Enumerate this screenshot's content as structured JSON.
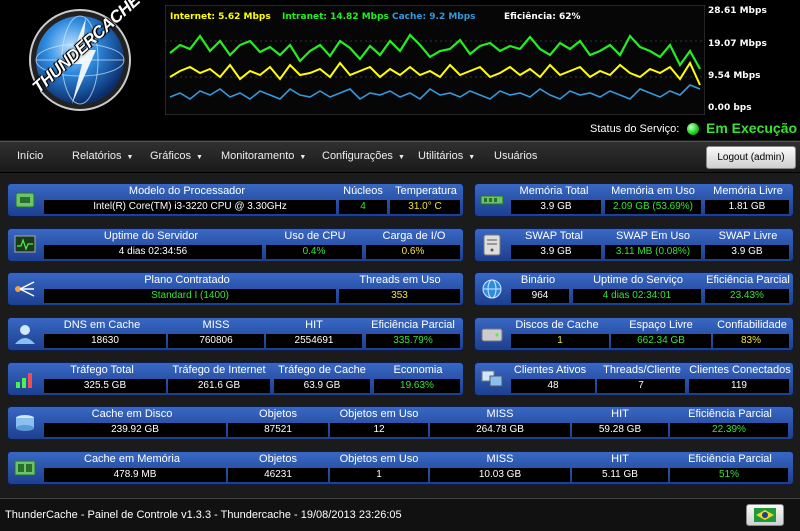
{
  "app": {
    "logo_text": "THUNDERCACHE",
    "legend": {
      "internet": "Internet: 5.62 Mbps",
      "intranet": "Intranet: 14.82 Mbps",
      "cache": "Cache: 9.2 Mbps",
      "eficiencia": "Eficiência: 62%"
    },
    "y_labels": [
      "28.61 Mbps",
      "19.07 Mbps",
      "9.54 Mbps",
      "0.00 bps"
    ],
    "status_label": "Status do Serviço:",
    "status_value": "Em Execução",
    "colors": {
      "internet": "#ffff00",
      "intranet": "#22ee22",
      "cache": "#3399dd",
      "eficiencia": "#ffffff",
      "value_green": "#37e237",
      "value_yellow": "#f2e23a"
    }
  },
  "nav": {
    "inicio": "Início",
    "relatorios": "Relatórios",
    "graficos": "Gráficos",
    "monitoramento": "Monitoramento",
    "configuracoes": "Configurações",
    "utilitarios": "Utilitários",
    "usuarios": "Usuários",
    "logout": "Logout (admin)"
  },
  "panels": {
    "cpu": {
      "icon": "chip-icon",
      "h": [
        "Modelo do Processador",
        "Núcleos",
        "Temperatura"
      ],
      "v": [
        "Intel(R) Core(TM) i3-3220 CPU @ 3.30GHz",
        "4",
        "31.0° C"
      ]
    },
    "mem": {
      "icon": "memory-icon",
      "h": [
        "Memória Total",
        "Memória em Uso",
        "Memória Livre"
      ],
      "v": [
        "3.9 GB",
        "2.09 GB (53.69%)",
        "1.81 GB"
      ]
    },
    "uptime": {
      "icon": "monitor-icon",
      "h": [
        "Uptime do Servidor",
        "Uso de CPU",
        "Carga de I/O"
      ],
      "v": [
        "4 dias 02:34:56",
        "0.4%",
        "0.6%"
      ]
    },
    "swap": {
      "icon": "server-icon",
      "h": [
        "SWAP Total",
        "SWAP Em Uso",
        "SWAP Livre"
      ],
      "v": [
        "3.9 GB",
        "3.11 MB (0.08%)",
        "3.9 GB"
      ]
    },
    "plano": {
      "icon": "network-icon",
      "h": [
        "Plano Contratado",
        "Threads em Uso"
      ],
      "v": [
        "Standard I (1400)",
        "353"
      ]
    },
    "binario": {
      "icon": "globe-icon",
      "h": [
        "Binário",
        "Uptime do Serviço",
        "Eficiência Parcial"
      ],
      "v": [
        "964",
        "4 dias 02:34:01",
        "23.43%"
      ]
    },
    "dns": {
      "icon": "user-icon",
      "h": [
        "DNS em Cache",
        "MISS",
        "HIT",
        "Eficiência Parcial"
      ],
      "v": [
        "18630",
        "760806",
        "2554691",
        "335.79%"
      ]
    },
    "discos": {
      "icon": "disk-icon",
      "h": [
        "Discos de Cache",
        "Espaço Livre",
        "Confiabilidade"
      ],
      "v": [
        "1",
        "662.34 GB",
        "83%"
      ]
    },
    "trafego": {
      "icon": "bars-icon",
      "h": [
        "Tráfego Total",
        "Tráfego de Internet",
        "Tráfego de Cache",
        "Economia"
      ],
      "v": [
        "325.5 GB",
        "261.6 GB",
        "63.9 GB",
        "19.63%"
      ]
    },
    "clientes": {
      "icon": "clients-icon",
      "h": [
        "Clientes Ativos",
        "Threads/Cliente",
        "Clientes Conectados"
      ],
      "v": [
        "48",
        "7",
        "119"
      ]
    },
    "cachedisco": {
      "icon": "stack-icon",
      "h": [
        "Cache em Disco",
        "Objetos",
        "Objetos em Uso",
        "MISS",
        "HIT",
        "Eficiência Parcial"
      ],
      "v": [
        "239.92 GB",
        "87521",
        "12",
        "264.78 GB",
        "59.28 GB",
        "22.39%"
      ]
    },
    "cachemem": {
      "icon": "memory-card-icon",
      "h": [
        "Cache em Memória",
        "Objetos",
        "Objetos em Uso",
        "MISS",
        "HIT",
        "Eficiência Parcial"
      ],
      "v": [
        "478.9 MB",
        "46231",
        "1",
        "10.03 GB",
        "5.11 GB",
        "51%"
      ]
    }
  },
  "footer": {
    "text": "ThunderCache - Painel de Controle v1.3.3 - Thundercache - 19/08/2013 23:26:05",
    "flag": "brazil-flag-icon"
  }
}
